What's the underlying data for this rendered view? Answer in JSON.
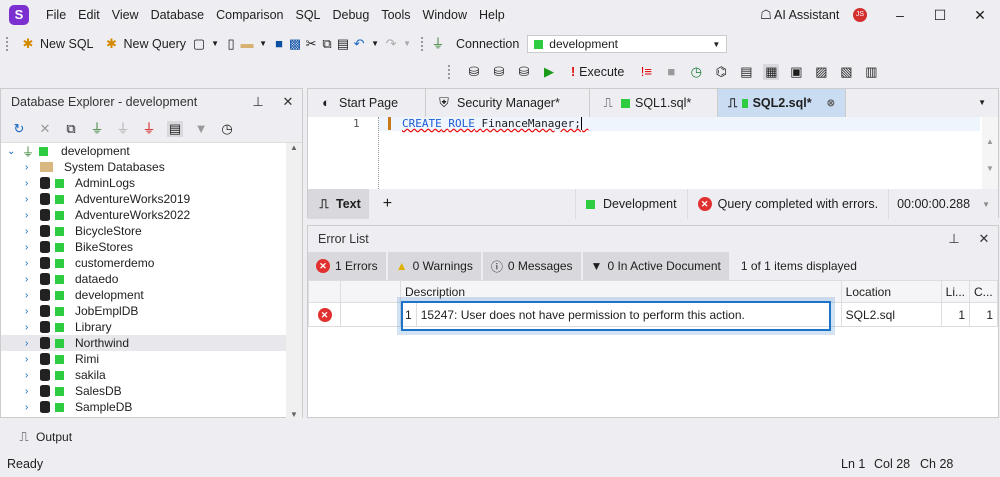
{
  "app": {
    "logo": "S",
    "menu": [
      "File",
      "Edit",
      "View",
      "Database",
      "Comparison",
      "SQL",
      "Debug",
      "Tools",
      "Window",
      "Help"
    ],
    "ai_assistant": "AI Assistant",
    "avatar": "JS"
  },
  "toolbar": {
    "new_sql": "New SQL",
    "new_query": "New Query",
    "connection_label": "Connection",
    "connection_value": "development",
    "execute": "Execute"
  },
  "db_explorer": {
    "title": "Database Explorer - development",
    "root": "development",
    "items": [
      "System Databases",
      "AdminLogs",
      "AdventureWorks2019",
      "AdventureWorks2022",
      "BicycleStore",
      "BikeStores",
      "customerdemo",
      "dataedo",
      "development",
      "JobEmplDB",
      "Library",
      "Northwind",
      "Rimi",
      "sakila",
      "SalesDB",
      "SampleDB"
    ],
    "selected": "Northwind"
  },
  "tabs": [
    {
      "label": "Start Page"
    },
    {
      "label": "Security Manager*"
    },
    {
      "label": "SQL1.sql*"
    },
    {
      "label": "SQL2.sql*",
      "active": true
    }
  ],
  "editor": {
    "line": "1",
    "code_kw1": "CREATE",
    "code_kw2": "ROLE",
    "code_rest": "FinanceManager;"
  },
  "editor_status": {
    "text_tab": "Text",
    "add": "+",
    "connection": "Development",
    "message": "Query completed with errors.",
    "elapsed": "00:00:00.288"
  },
  "error_list": {
    "title": "Error List",
    "filters": {
      "errors": "1 Errors",
      "warnings": "0 Warnings",
      "messages": "0 Messages",
      "active_doc": "0 In Active Document"
    },
    "summary": "1 of 1 items displayed",
    "columns": [
      "Description",
      "Location",
      "Li...",
      "C..."
    ],
    "rows": [
      {
        "num": "1",
        "code": "15247:",
        "description": "User does not have permission to perform this action.",
        "location": "SQL2.sql",
        "line": "1",
        "col": "1"
      }
    ]
  },
  "output_tab": "Output",
  "status": {
    "text": "Ready",
    "ln": "Ln 1",
    "col": "Col 28",
    "ch": "Ch 28"
  },
  "colors": {
    "accent": "#1e73c8",
    "connection_green": "#2ecc40",
    "error_red": "#e03030"
  }
}
